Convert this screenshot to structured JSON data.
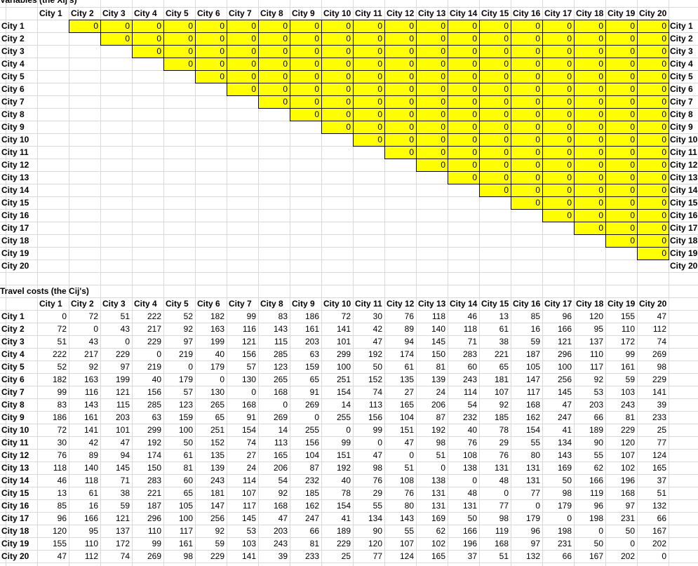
{
  "variables": {
    "title": "Variables (the Xij's)",
    "columns": [
      "City 1",
      "City 2",
      "City 3",
      "City 4",
      "City 5",
      "City 6",
      "City 7",
      "City 8",
      "City 9",
      "City 10",
      "City 11",
      "City 12",
      "City 13",
      "City 14",
      "City 15",
      "City 16",
      "City 17",
      "City 18",
      "City 19",
      "City 20"
    ],
    "rows": [
      "City 1",
      "City 2",
      "City 3",
      "City 4",
      "City 5",
      "City 6",
      "City 7",
      "City 8",
      "City 9",
      "City 10",
      "City 11",
      "City 12",
      "City 13",
      "City 14",
      "City 15",
      "City 16",
      "City 17",
      "City 18",
      "City 19",
      "City 20"
    ],
    "right_labels": [
      "City 1",
      "City 2",
      "City 3",
      "City 4",
      "City 5",
      "City 6",
      "City 7",
      "City 8",
      "City 9",
      "City 10",
      "City 11",
      "City 12",
      "City 13",
      "City 14",
      "City 15",
      "City 16",
      "City 17",
      "City 18",
      "City 19",
      "City 20"
    ],
    "values": [
      [
        0,
        0,
        0,
        0,
        0,
        0,
        0,
        0,
        0,
        0,
        0,
        0,
        0,
        0,
        0,
        0,
        0,
        0,
        0
      ],
      [
        0,
        0,
        0,
        0,
        0,
        0,
        0,
        0,
        0,
        0,
        0,
        0,
        0,
        0,
        0,
        0,
        0,
        0
      ],
      [
        0,
        0,
        0,
        0,
        0,
        0,
        0,
        0,
        0,
        0,
        0,
        0,
        0,
        0,
        0,
        0,
        0
      ],
      [
        0,
        0,
        0,
        0,
        0,
        0,
        0,
        0,
        0,
        0,
        0,
        0,
        0,
        0,
        0,
        0
      ],
      [
        0,
        0,
        0,
        0,
        0,
        0,
        0,
        0,
        0,
        0,
        0,
        0,
        0,
        0,
        0
      ],
      [
        0,
        0,
        0,
        0,
        0,
        0,
        0,
        0,
        0,
        0,
        0,
        0,
        0,
        0
      ],
      [
        0,
        0,
        0,
        0,
        0,
        0,
        0,
        0,
        0,
        0,
        0,
        0,
        0
      ],
      [
        0,
        0,
        0,
        0,
        0,
        0,
        0,
        0,
        0,
        0,
        0,
        0
      ],
      [
        0,
        0,
        0,
        0,
        0,
        0,
        0,
        0,
        0,
        0,
        0
      ],
      [
        0,
        0,
        0,
        0,
        0,
        0,
        0,
        0,
        0,
        0
      ],
      [
        0,
        0,
        0,
        0,
        0,
        0,
        0,
        0,
        0
      ],
      [
        0,
        0,
        0,
        0,
        0,
        0,
        0,
        0
      ],
      [
        0,
        0,
        0,
        0,
        0,
        0,
        0
      ],
      [
        0,
        0,
        0,
        0,
        0,
        0
      ],
      [
        0,
        0,
        0,
        0,
        0
      ],
      [
        0,
        0,
        0,
        0
      ],
      [
        0,
        0,
        0
      ],
      [
        0,
        0
      ],
      [
        0
      ],
      []
    ],
    "highlight_color": "#ffff00"
  },
  "costs": {
    "title": "Travel costs (the Cij's)",
    "columns": [
      "City 1",
      "City 2",
      "City 3",
      "City 4",
      "City 5",
      "City 6",
      "City 7",
      "City 8",
      "City 9",
      "City 10",
      "City 11",
      "City 12",
      "City 13",
      "City 14",
      "City 15",
      "City 16",
      "City 17",
      "City 18",
      "City 19",
      "City 20"
    ],
    "rows": [
      "City 1",
      "City 2",
      "City 3",
      "City 4",
      "City 5",
      "City 6",
      "City 7",
      "City 8",
      "City 9",
      "City 10",
      "City 11",
      "City 12",
      "City 13",
      "City 14",
      "City 15",
      "City 16",
      "City 17",
      "City 18",
      "City 19",
      "City 20"
    ],
    "values": [
      [
        0,
        72,
        51,
        222,
        52,
        182,
        99,
        83,
        186,
        72,
        30,
        76,
        118,
        46,
        13,
        85,
        96,
        120,
        155,
        47
      ],
      [
        72,
        0,
        43,
        217,
        92,
        163,
        116,
        143,
        161,
        141,
        42,
        89,
        140,
        118,
        61,
        16,
        166,
        95,
        110,
        112
      ],
      [
        51,
        43,
        0,
        229,
        97,
        199,
        121,
        115,
        203,
        101,
        47,
        94,
        145,
        71,
        38,
        59,
        121,
        137,
        172,
        74
      ],
      [
        222,
        217,
        229,
        0,
        219,
        40,
        156,
        285,
        63,
        299,
        192,
        174,
        150,
        283,
        221,
        187,
        296,
        110,
        99,
        269
      ],
      [
        52,
        92,
        97,
        219,
        0,
        179,
        57,
        123,
        159,
        100,
        50,
        61,
        81,
        60,
        65,
        105,
        100,
        117,
        161,
        98
      ],
      [
        182,
        163,
        199,
        40,
        179,
        0,
        130,
        265,
        65,
        251,
        152,
        135,
        139,
        243,
        181,
        147,
        256,
        92,
        59,
        229
      ],
      [
        99,
        116,
        121,
        156,
        57,
        130,
        0,
        168,
        91,
        154,
        74,
        27,
        24,
        114,
        107,
        117,
        145,
        53,
        103,
        141
      ],
      [
        83,
        143,
        115,
        285,
        123,
        265,
        168,
        0,
        269,
        14,
        113,
        165,
        206,
        54,
        92,
        168,
        47,
        203,
        243,
        39
      ],
      [
        186,
        161,
        203,
        63,
        159,
        65,
        91,
        269,
        0,
        255,
        156,
        104,
        87,
        232,
        185,
        162,
        247,
        66,
        81,
        233
      ],
      [
        72,
        141,
        101,
        299,
        100,
        251,
        154,
        14,
        255,
        0,
        99,
        151,
        192,
        40,
        78,
        154,
        41,
        189,
        229,
        25
      ],
      [
        30,
        42,
        47,
        192,
        50,
        152,
        74,
        113,
        156,
        99,
        0,
        47,
        98,
        76,
        29,
        55,
        134,
        90,
        120,
        77
      ],
      [
        76,
        89,
        94,
        174,
        61,
        135,
        27,
        165,
        104,
        151,
        47,
        0,
        51,
        108,
        76,
        80,
        143,
        55,
        107,
        124
      ],
      [
        118,
        140,
        145,
        150,
        81,
        139,
        24,
        206,
        87,
        192,
        98,
        51,
        0,
        138,
        131,
        131,
        169,
        62,
        102,
        165
      ],
      [
        46,
        118,
        71,
        283,
        60,
        243,
        114,
        54,
        232,
        40,
        76,
        108,
        138,
        0,
        48,
        131,
        50,
        166,
        196,
        37
      ],
      [
        13,
        61,
        38,
        221,
        65,
        181,
        107,
        92,
        185,
        78,
        29,
        76,
        131,
        48,
        0,
        77,
        98,
        119,
        168,
        51
      ],
      [
        85,
        16,
        59,
        187,
        105,
        147,
        117,
        168,
        162,
        154,
        55,
        80,
        131,
        131,
        77,
        0,
        179,
        96,
        97,
        132
      ],
      [
        96,
        166,
        121,
        296,
        100,
        256,
        145,
        47,
        247,
        41,
        134,
        143,
        169,
        50,
        98,
        179,
        0,
        198,
        231,
        66
      ],
      [
        120,
        95,
        137,
        110,
        117,
        92,
        53,
        203,
        66,
        189,
        90,
        55,
        62,
        166,
        119,
        96,
        198,
        0,
        50,
        167
      ],
      [
        155,
        110,
        172,
        99,
        161,
        59,
        103,
        243,
        81,
        229,
        120,
        107,
        102,
        196,
        168,
        97,
        231,
        50,
        0,
        202
      ],
      [
        47,
        112,
        74,
        269,
        98,
        229,
        141,
        39,
        233,
        25,
        77,
        124,
        165,
        37,
        51,
        132,
        66,
        167,
        202,
        0
      ]
    ]
  }
}
